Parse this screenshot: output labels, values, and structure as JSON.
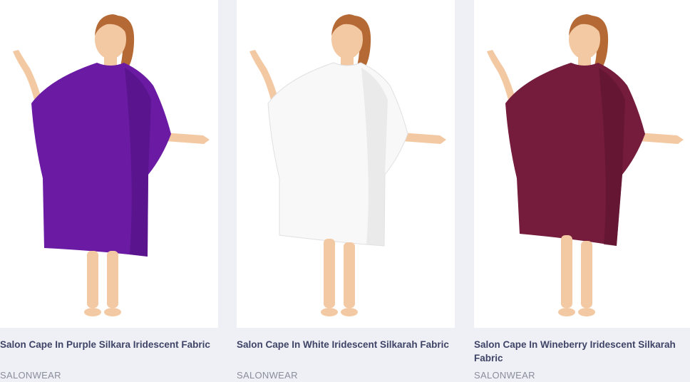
{
  "products": [
    {
      "title": "Salon Cape In Purple Silkara Iridescent Fabric",
      "brand": "SALONWEAR",
      "cape_color": "#6a1aa3",
      "cape_shade": "#4f1180"
    },
    {
      "title": "Salon Cape In White Iridescent Silkarah Fabric",
      "brand": "SALONWEAR",
      "cape_color": "#f8f8f8",
      "cape_shade": "#e4e4e6"
    },
    {
      "title": "Salon Cape In Wineberry Iridescent Silkarah Fabric",
      "brand": "SALONWEAR",
      "cape_color": "#751c3c",
      "cape_shade": "#5a132d"
    }
  ],
  "colors": {
    "page_background": "#eef0f5",
    "title_text": "#3f4467",
    "brand_text": "#8a8d9c",
    "skin": "#f3c9a3",
    "hair": "#b56a36"
  }
}
